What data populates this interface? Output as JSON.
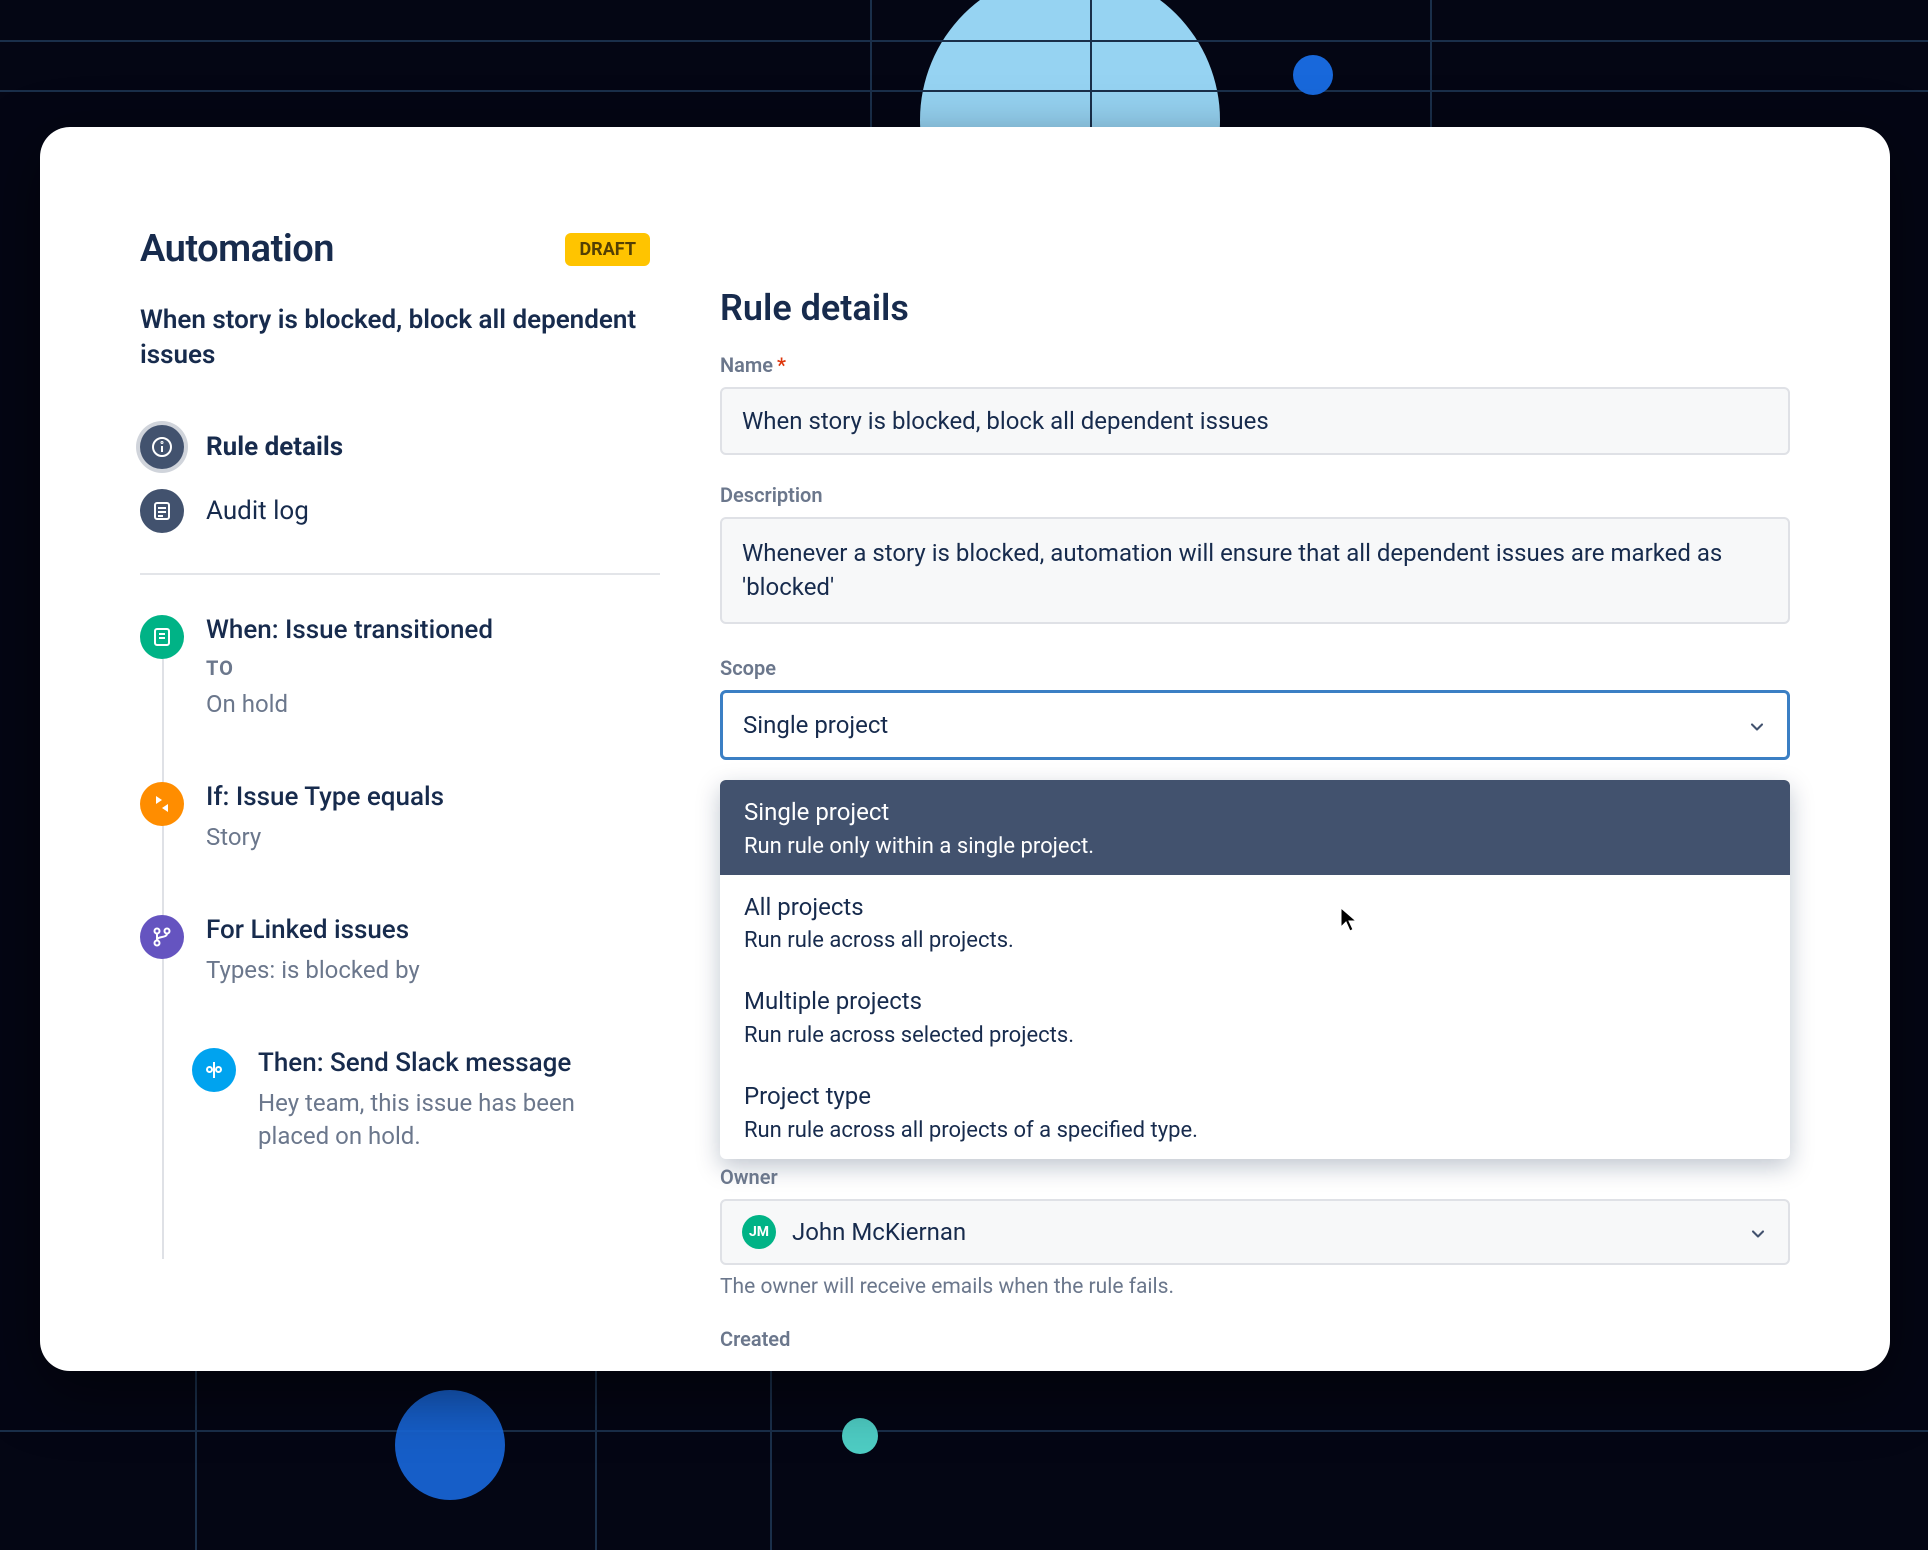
{
  "header": {
    "title": "Automation",
    "badge": "DRAFT",
    "ruleName": "When story is blocked, block all dependent issues"
  },
  "nav": {
    "ruleDetails": "Rule details",
    "auditLog": "Audit log"
  },
  "steps": {
    "trigger": {
      "title": "When: Issue transitioned",
      "meta": "TO",
      "sub": "On hold"
    },
    "condition": {
      "title": "If: Issue Type equals",
      "sub": "Story"
    },
    "branch": {
      "title": "For Linked issues",
      "sub": "Types: is blocked by"
    },
    "action": {
      "title": "Then: Send Slack message",
      "sub": "Hey team, this issue has been placed on hold."
    }
  },
  "details": {
    "sectionTitle": "Rule details",
    "nameLabel": "Name",
    "nameValue": "When story is blocked, block all dependent issues",
    "descLabel": "Description",
    "descValue": "Whenever a story is blocked, automation will ensure that all dependent issues are marked as 'blocked'",
    "scopeLabel": "Scope",
    "scopeValue": "Single project",
    "scopeOptions": [
      {
        "title": "Single project",
        "desc": "Run rule only within a single project."
      },
      {
        "title": "All projects",
        "desc": "Run rule across all projects."
      },
      {
        "title": "Multiple projects",
        "desc": "Run rule across selected projects."
      },
      {
        "title": "Project type",
        "desc": "Run rule across all projects of a specified type."
      }
    ],
    "ownerLabel": "Owner",
    "ownerName": "John McKiernan",
    "ownerInitials": "JM",
    "ownerHelp": "The owner will receive emails when the rule fails.",
    "createdLabel": "Created"
  }
}
